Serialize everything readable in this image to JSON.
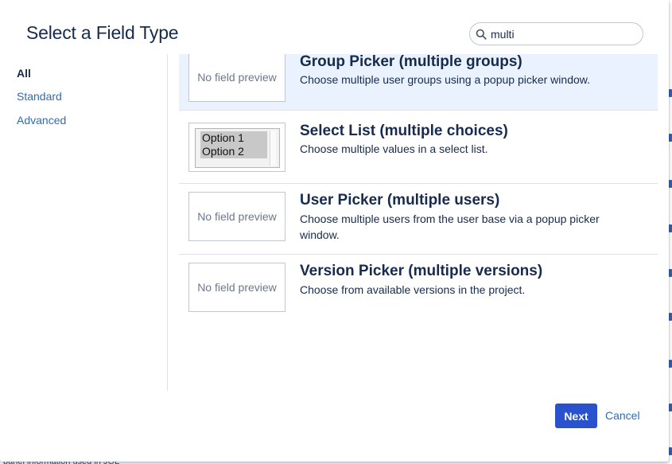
{
  "dialog": {
    "title": "Select a Field Type"
  },
  "search": {
    "value": "multi",
    "icon": "search-icon"
  },
  "sidebar": {
    "items": [
      {
        "label": "All",
        "active": true
      },
      {
        "label": "Standard",
        "active": false
      },
      {
        "label": "Advanced",
        "active": false
      }
    ]
  },
  "fields": [
    {
      "title": "Group Picker (multiple groups)",
      "description": "Choose multiple user groups using a popup picker window.",
      "preview": "No field preview",
      "selected": true
    },
    {
      "title": "Select List (multiple choices)",
      "description": "Choose multiple values in a select list.",
      "preview_options": [
        "Option 1",
        "Option 2"
      ],
      "selected": false
    },
    {
      "title": "User Picker (multiple users)",
      "description": "Choose multiple users from the user base via a popup picker window.",
      "preview": "No field preview",
      "selected": false
    },
    {
      "title": "Version Picker (multiple versions)",
      "description": "Choose from available versions in the project.",
      "preview": "No field preview",
      "selected": false
    }
  ],
  "footer": {
    "next_label": "Next",
    "cancel_label": "Cancel"
  },
  "background": {
    "bottom_text": "panel information used in JQL"
  },
  "colors": {
    "primary": "#2952cc",
    "link": "#2f6cb3",
    "selected_row": "#e9f2fe",
    "text": "#172b4d"
  }
}
